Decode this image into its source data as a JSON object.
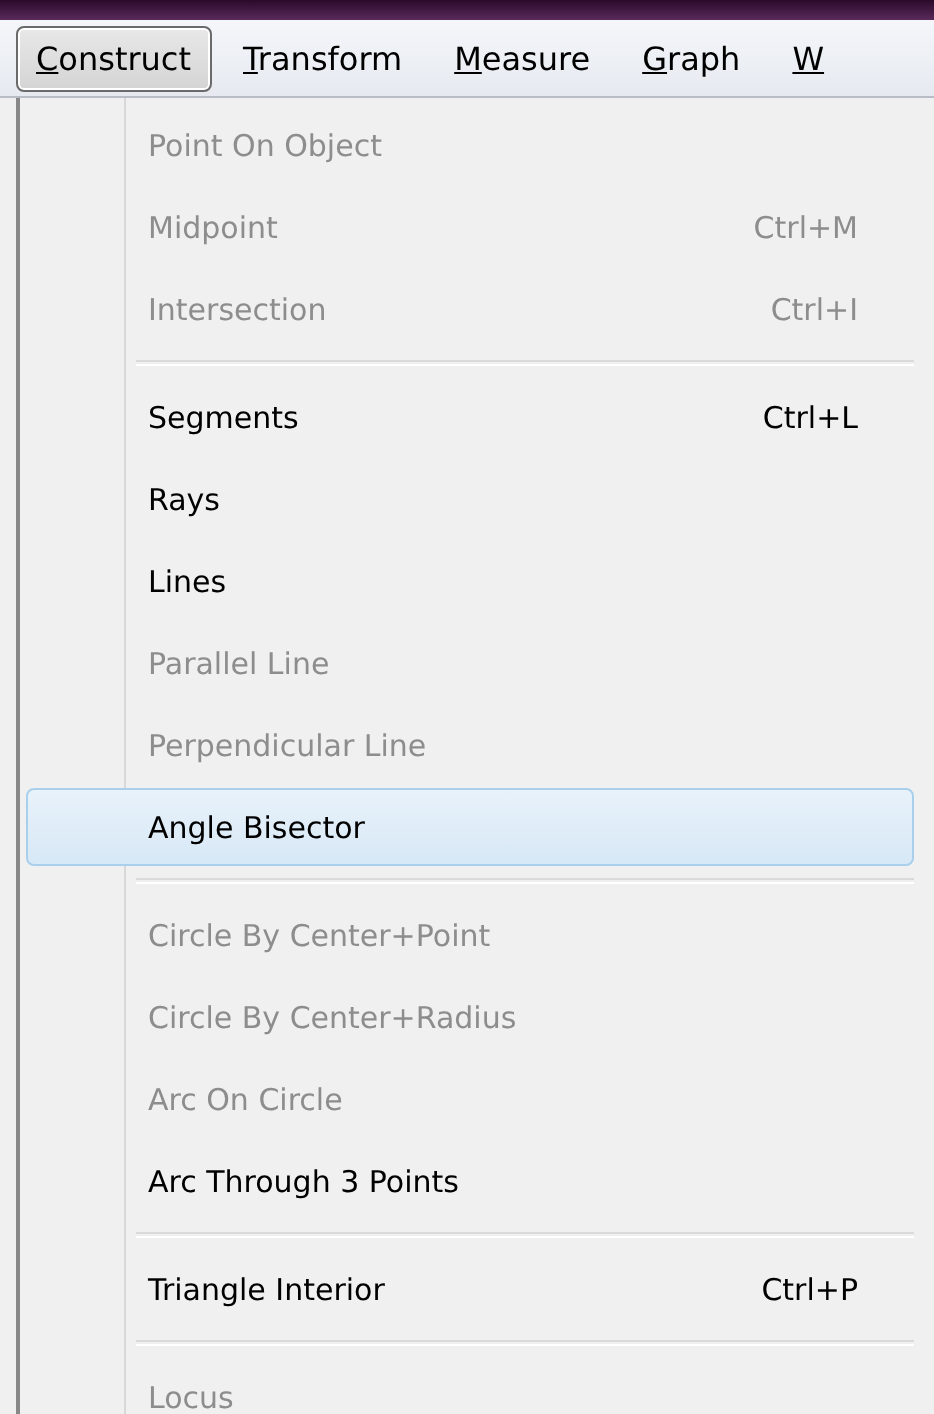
{
  "menubar": [
    {
      "label": "Construct",
      "selected": true
    },
    {
      "label": "Transform",
      "selected": false
    },
    {
      "label": "Measure",
      "selected": false
    },
    {
      "label": "Graph",
      "selected": false
    },
    {
      "label": "W",
      "selected": false
    }
  ],
  "menu": {
    "items": [
      {
        "kind": "item",
        "label": "Point On Object",
        "disabled": true,
        "selected": false
      },
      {
        "kind": "item",
        "label": "Midpoint",
        "shortcut": "Ctrl+M",
        "disabled": true,
        "selected": false
      },
      {
        "kind": "item",
        "label": "Intersection",
        "shortcut": "Ctrl+I",
        "disabled": true,
        "selected": false
      },
      {
        "kind": "separator"
      },
      {
        "kind": "item",
        "label": "Segments",
        "shortcut": "Ctrl+L",
        "disabled": false,
        "selected": false
      },
      {
        "kind": "item",
        "label": "Rays",
        "disabled": false,
        "selected": false
      },
      {
        "kind": "item",
        "label": "Lines",
        "disabled": false,
        "selected": false
      },
      {
        "kind": "item",
        "label": "Parallel Line",
        "disabled": true,
        "selected": false
      },
      {
        "kind": "item",
        "label": "Perpendicular Line",
        "disabled": true,
        "selected": false
      },
      {
        "kind": "item",
        "label": "Angle Bisector",
        "disabled": false,
        "selected": true
      },
      {
        "kind": "separator"
      },
      {
        "kind": "item",
        "label": "Circle By Center+Point",
        "disabled": true,
        "selected": false
      },
      {
        "kind": "item",
        "label": "Circle By Center+Radius",
        "disabled": true,
        "selected": false
      },
      {
        "kind": "item",
        "label": "Arc On Circle",
        "disabled": true,
        "selected": false
      },
      {
        "kind": "item",
        "label": "Arc Through 3 Points",
        "disabled": false,
        "selected": false
      },
      {
        "kind": "separator"
      },
      {
        "kind": "item",
        "label": "Triangle Interior",
        "shortcut": "Ctrl+P",
        "disabled": false,
        "selected": false
      },
      {
        "kind": "separator"
      },
      {
        "kind": "item",
        "label": "Locus",
        "disabled": true,
        "selected": false
      }
    ]
  }
}
